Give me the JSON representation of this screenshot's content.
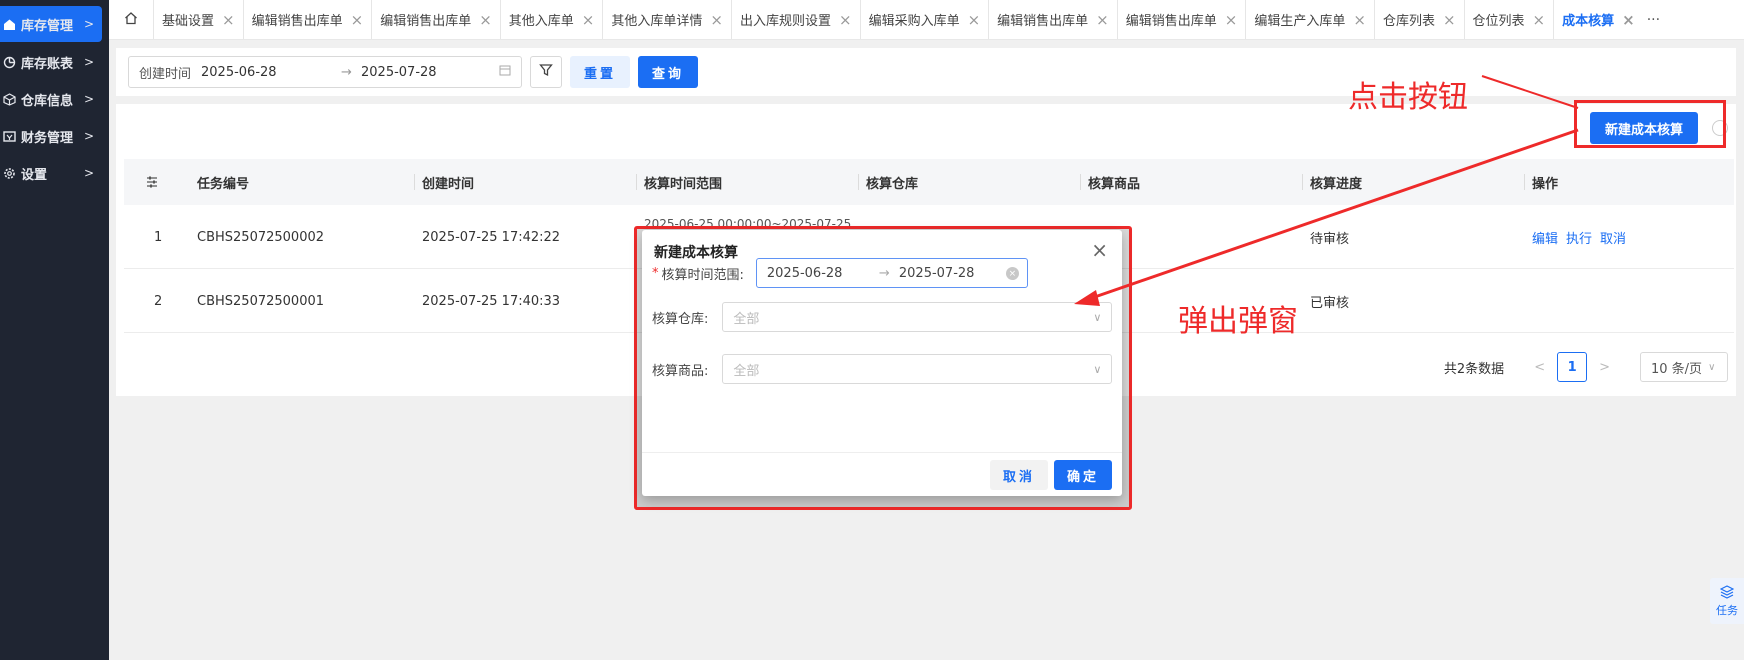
{
  "sidebar": {
    "items": [
      {
        "label": "库存管理",
        "icon": "home-icon",
        "active": true
      },
      {
        "label": "库存账表",
        "icon": "chart-icon",
        "active": false
      },
      {
        "label": "仓库信息",
        "icon": "cube-icon",
        "active": false
      },
      {
        "label": "财务管理",
        "icon": "wallet-icon",
        "active": false
      },
      {
        "label": "设置",
        "icon": "gear-icon",
        "active": false
      }
    ]
  },
  "tabs": [
    {
      "label": "基础设置"
    },
    {
      "label": "编辑销售出库单"
    },
    {
      "label": "编辑销售出库单"
    },
    {
      "label": "其他入库单"
    },
    {
      "label": "其他入库单详情"
    },
    {
      "label": "出入库规则设置"
    },
    {
      "label": "编辑采购入库单"
    },
    {
      "label": "编辑销售出库单"
    },
    {
      "label": "编辑销售出库单"
    },
    {
      "label": "编辑生产入库单"
    },
    {
      "label": "仓库列表"
    },
    {
      "label": "仓位列表"
    },
    {
      "label": "成本核算",
      "active": true
    }
  ],
  "tab_more": "···",
  "filter": {
    "label": "创建时间",
    "start_date": "2025-06-28",
    "end_date": "2025-07-28",
    "arrow": "→",
    "reset_label": "重置",
    "query_label": "查询"
  },
  "toolbar": {
    "new_label": "新建成本核算"
  },
  "table": {
    "columns": [
      "任务编号",
      "创建时间",
      "核算时间范围",
      "核算仓库",
      "核算商品",
      "核算进度",
      "操作"
    ],
    "rows": [
      {
        "index": "1",
        "task_no": "CBHS25072500002",
        "created": "2025-07-25 17:42:22",
        "range": "2025-06-25 00:00:00~2025-07-25",
        "progress": "待审核",
        "ops": [
          "编辑",
          "执行",
          "取消"
        ]
      },
      {
        "index": "2",
        "task_no": "CBHS25072500001",
        "created": "2025-07-25 17:40:33",
        "range": "",
        "progress": "已审核",
        "ops": []
      }
    ]
  },
  "pager": {
    "total": "共2条数据",
    "current": "1",
    "page_size": "10 条/页"
  },
  "modal": {
    "title": "新建成本核算",
    "range_label": "核算时间范围:",
    "range_start": "2025-06-28",
    "range_end": "2025-07-28",
    "range_arrow": "→",
    "warehouse_label": "核算仓库:",
    "warehouse_placeholder": "全部",
    "goods_label": "核算商品:",
    "goods_placeholder": "全部",
    "cancel_label": "取消",
    "ok_label": "确定"
  },
  "annotations": {
    "click_button": "点击按钮",
    "popup": "弹出弹窗"
  },
  "float_task": {
    "label": "任务"
  },
  "colors": {
    "accent": "#1b6ef3",
    "sidebar_bg": "#1f2532",
    "annotation": "#ee2a2a"
  }
}
